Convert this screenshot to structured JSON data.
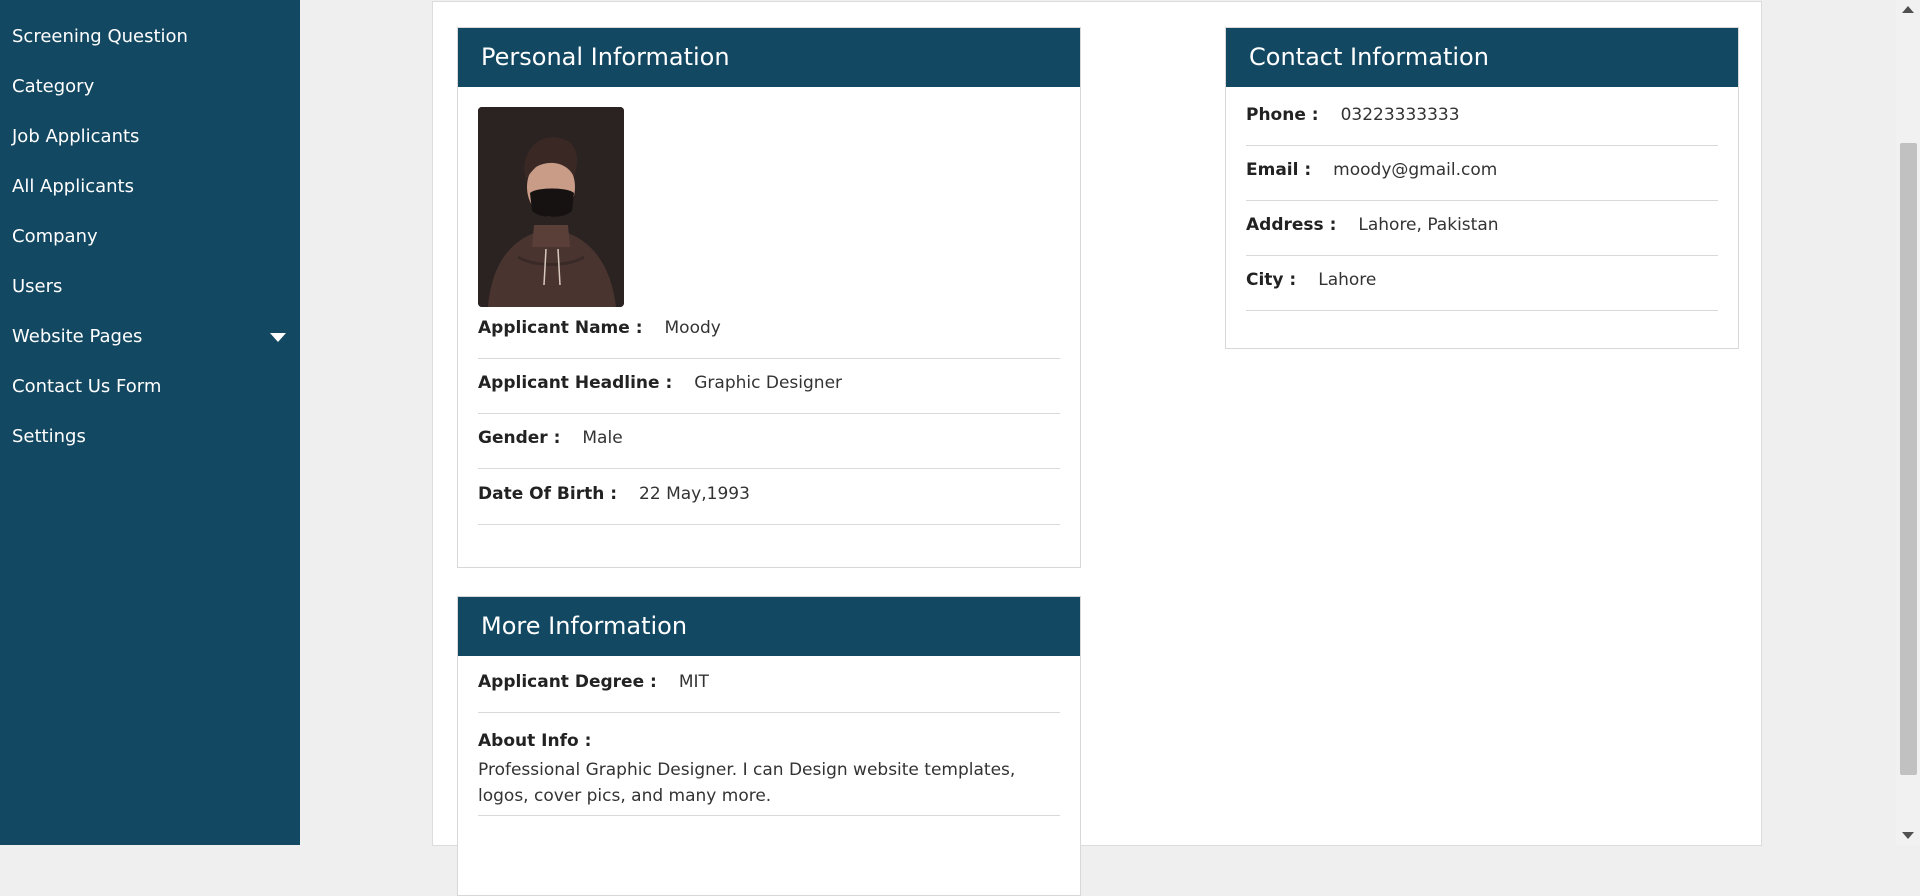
{
  "sidebar": {
    "items": [
      {
        "label": "Screening Question"
      },
      {
        "label": "Category"
      },
      {
        "label": "Job Applicants"
      },
      {
        "label": "All Applicants"
      },
      {
        "label": "Company"
      },
      {
        "label": "Users"
      },
      {
        "label": "Website Pages",
        "icon": "caret-down-icon"
      },
      {
        "label": "Contact Us Form"
      },
      {
        "label": "Settings"
      }
    ]
  },
  "personal": {
    "title": "Personal Information",
    "fields": [
      {
        "label": "Applicant Name :",
        "value": "Moody"
      },
      {
        "label": "Applicant Headline :",
        "value": "Graphic Designer"
      },
      {
        "label": "Gender :",
        "value": "Male"
      },
      {
        "label": "Date Of Birth :",
        "value": "22 May,1993"
      }
    ]
  },
  "contact": {
    "title": "Contact Information",
    "fields": [
      {
        "label": "Phone :",
        "value": "03223333333"
      },
      {
        "label": "Email :",
        "value": "moody@gmail.com"
      },
      {
        "label": "Address :",
        "value": "Lahore, Pakistan"
      },
      {
        "label": "City :",
        "value": "Lahore"
      }
    ]
  },
  "more": {
    "title": "More Information",
    "degree": {
      "label": "Applicant Degree :",
      "value": "MIT"
    },
    "about": {
      "label": "About Info :",
      "value": "Professional Graphic Designer. I can Design website templates, logos, cover pics, and many more."
    }
  },
  "colors": {
    "brand": "#134862",
    "background": "#efefef"
  }
}
